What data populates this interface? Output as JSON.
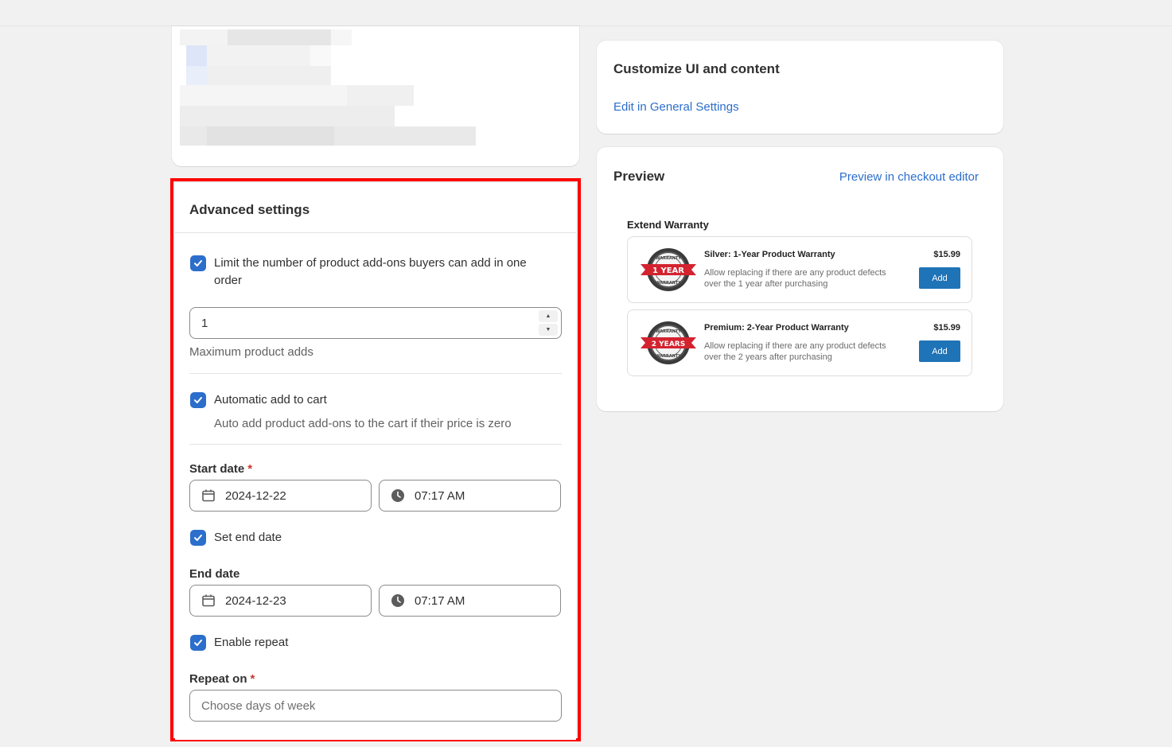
{
  "advanced": {
    "title": "Advanced settings",
    "limit_label": "Limit the number of product add-ons buyers can add in one order",
    "limit_value": "1",
    "limit_help": "Maximum product adds",
    "auto_label": "Automatic add to cart",
    "auto_help": "Auto add product add-ons to the cart if their price is zero",
    "start_label": "Start date",
    "start_date": "2024-12-22",
    "start_time": "07:17 AM",
    "end_toggle_label": "Set end date",
    "end_label": "End date",
    "end_date": "2024-12-23",
    "end_time": "07:17 AM",
    "repeat_label": "Enable repeat",
    "repeat_on_label": "Repeat on",
    "repeat_on_placeholder": "Choose days of week",
    "required_mark": "*"
  },
  "customize": {
    "title": "Customize UI and content",
    "link": "Edit in General Settings"
  },
  "preview": {
    "title": "Preview",
    "link": "Preview in checkout editor",
    "heading": "Extend Warranty",
    "offers": [
      {
        "name": "Silver: 1-Year Product Warranty",
        "desc": "Allow replacing if there are any product defects over the 1 year after purchasing",
        "price": "$15.99",
        "button": "Add",
        "badge_text": "1 YEAR"
      },
      {
        "name": "Premium: 2-Year Product Warranty",
        "desc": "Allow replacing if there are any product defects over the 2 years after purchasing",
        "price": "$15.99",
        "button": "Add",
        "badge_text": "2 YEARS"
      }
    ],
    "badge_ring_text": "WARRANTY"
  },
  "colors": {
    "accent": "#2c6ecb",
    "highlight": "#ff0000",
    "add_button": "#1f73b7",
    "badge_red": "#d3232f"
  }
}
